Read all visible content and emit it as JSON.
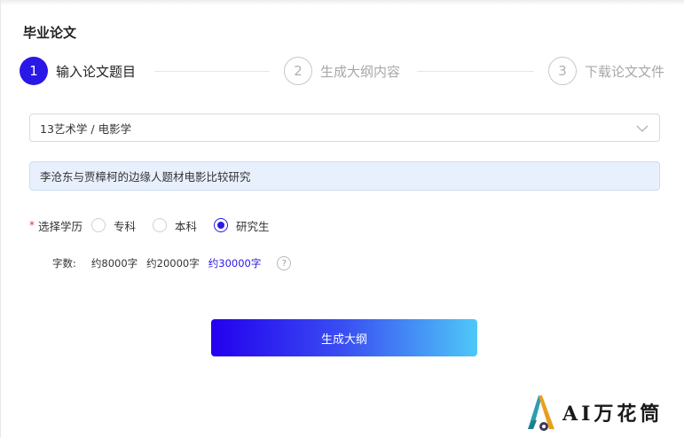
{
  "page": {
    "title": "毕业论文"
  },
  "steps": [
    {
      "number": "1",
      "label": "输入论文题目",
      "state": "active"
    },
    {
      "number": "2",
      "label": "生成大纲内容",
      "state": "inactive"
    },
    {
      "number": "3",
      "label": "下载论文文件",
      "state": "inactive"
    }
  ],
  "subject_select": {
    "value": "13艺术学 / 电影学",
    "icon": "chevron-down-icon"
  },
  "topic_input": {
    "value": "李沧东与贾樟柯的边缘人题材电影比较研究"
  },
  "education": {
    "required_mark": "*",
    "label": "选择学历",
    "options": [
      "专科",
      "本科",
      "研究生"
    ],
    "selected": "研究生"
  },
  "word_count": {
    "label": "字数:",
    "options": [
      "约8000字",
      "约20000字",
      "约30000字"
    ],
    "selected": "约30000字",
    "help": "?"
  },
  "generate_button": {
    "label": "生成大纲"
  },
  "logo": {
    "text": "AI万花筒"
  },
  "colors": {
    "accent": "#2a18e6",
    "button_gradient_end": "#4ec8f8",
    "topic_bg": "#e8f0fd"
  }
}
